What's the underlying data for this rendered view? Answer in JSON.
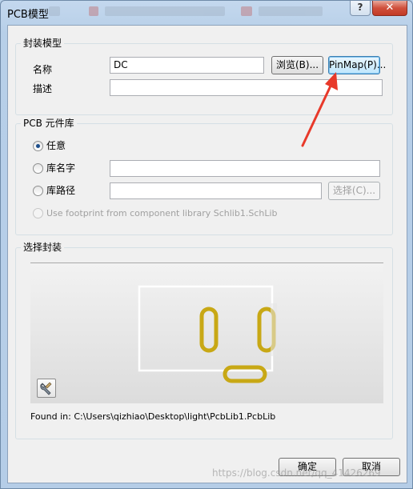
{
  "window": {
    "title": "PCB模型",
    "help_label": "?",
    "close_label": "✕"
  },
  "model_group": {
    "legend": "封装模型",
    "name_label": "名称",
    "name_value": "DC",
    "browse_label": "浏览(B)...",
    "pinmap_label": "PinMap(P)...",
    "desc_label": "描述",
    "desc_value": ""
  },
  "library_group": {
    "legend": "PCB 元件库",
    "options": [
      {
        "label": "任意",
        "selected": true,
        "enabled": true
      },
      {
        "label": "库名字",
        "selected": false,
        "enabled": true
      },
      {
        "label": "库路径",
        "selected": false,
        "enabled": true
      },
      {
        "label": "Use footprint from component library Schlib1.SchLib",
        "selected": false,
        "enabled": false
      }
    ],
    "lib_name_value": "",
    "lib_path_value": "",
    "select_label": "选择(C)..."
  },
  "footprint_group": {
    "legend": "选择封装",
    "found_in": "Found in:  C:\\Users\\qizhiao\\Desktop\\light\\PcbLib1.PcbLib",
    "tool_icon": "wrench-tool-icon"
  },
  "footer": {
    "ok_label": "确定",
    "cancel_label": "取消"
  },
  "watermark": "https://blog.csdn.net/qq_41426269",
  "colors": {
    "arrow": "#e8392a",
    "pad": "#c8a815",
    "selection_box": "#ffffff"
  }
}
